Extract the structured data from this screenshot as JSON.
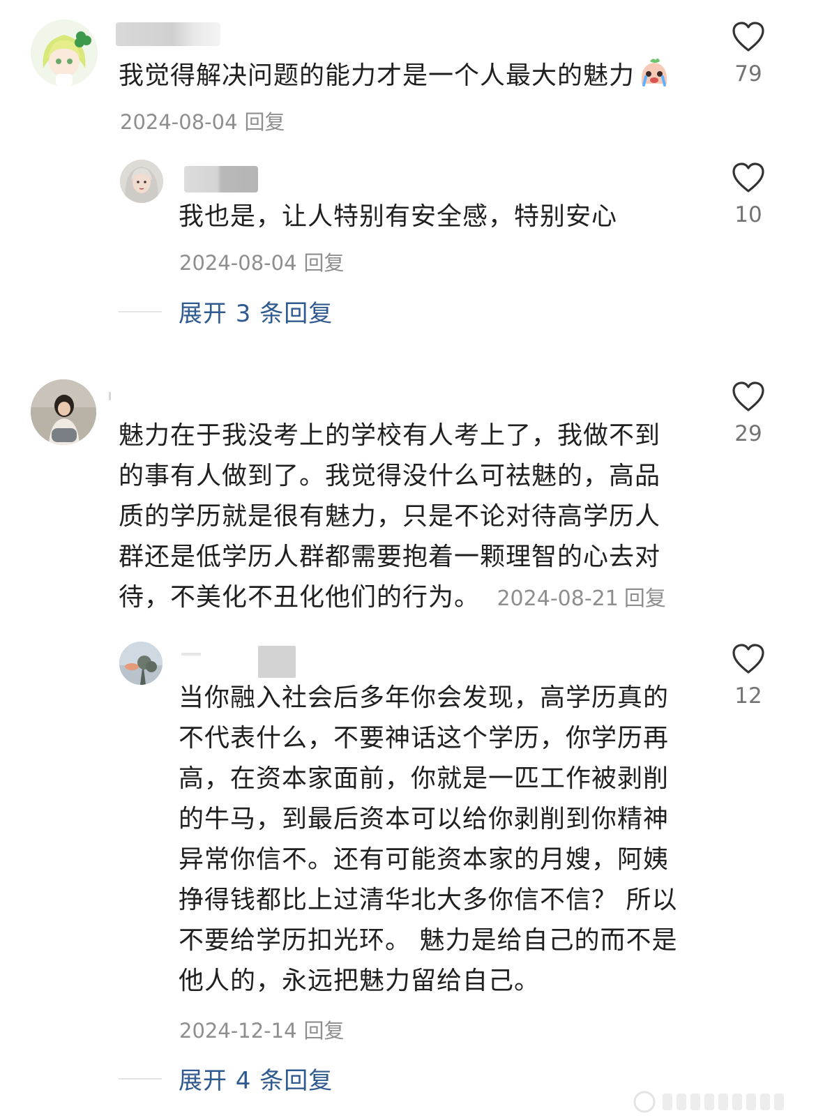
{
  "comments": [
    {
      "text": "我觉得解决问题的能力才是一个人最大的魅力",
      "date": "2024-08-04",
      "reply_label": "回复",
      "likes": "79",
      "emoji": "crying-face-emoji",
      "replies": [
        {
          "text": "我也是，让人特别有安全感，特别安心",
          "date": "2024-08-04",
          "reply_label": "回复",
          "likes": "10"
        }
      ],
      "expand_label": "展开 3 条回复"
    },
    {
      "text_lines": [
        "魅力在于我没考上的学校有人考上了，我做不到",
        "的事有人做到了。我觉得没什么可祛魅的，高品",
        "质的学历就是很有魅力，只是不论对待高学历人",
        "群还是低学历人群都需要抱着一颗理智的心去对",
        "待，不美化不丑化他们的行为。"
      ],
      "date": "2024-08-21",
      "reply_label": "回复",
      "likes": "29",
      "replies": [
        {
          "text_lines": [
            "当你融入社会后多年你会发现，高学历真的",
            "不代表什么，不要神话这个学历，你学历再",
            "高，在资本家面前，你就是一匹工作被剥削",
            "的牛马，到最后资本可以给你剥削到你精神",
            "异常你信不。还有可能资本家的月嫂，阿姨",
            "挣得钱都比上过清华北大多你信不信？ 所以",
            "不要给学历扣光环。 魅力是给自己的而不是",
            "他人的，永远把魅力留给自己。"
          ],
          "date": "2024-12-14",
          "reply_label": "回复",
          "likes": "12"
        }
      ],
      "expand_label": "展开 4 条回复"
    }
  ],
  "icons": {
    "like": "heart-outline-icon"
  },
  "colors": {
    "link": "#2f5a8f",
    "meta": "#8e8e8e",
    "text": "#1f1f1f"
  }
}
